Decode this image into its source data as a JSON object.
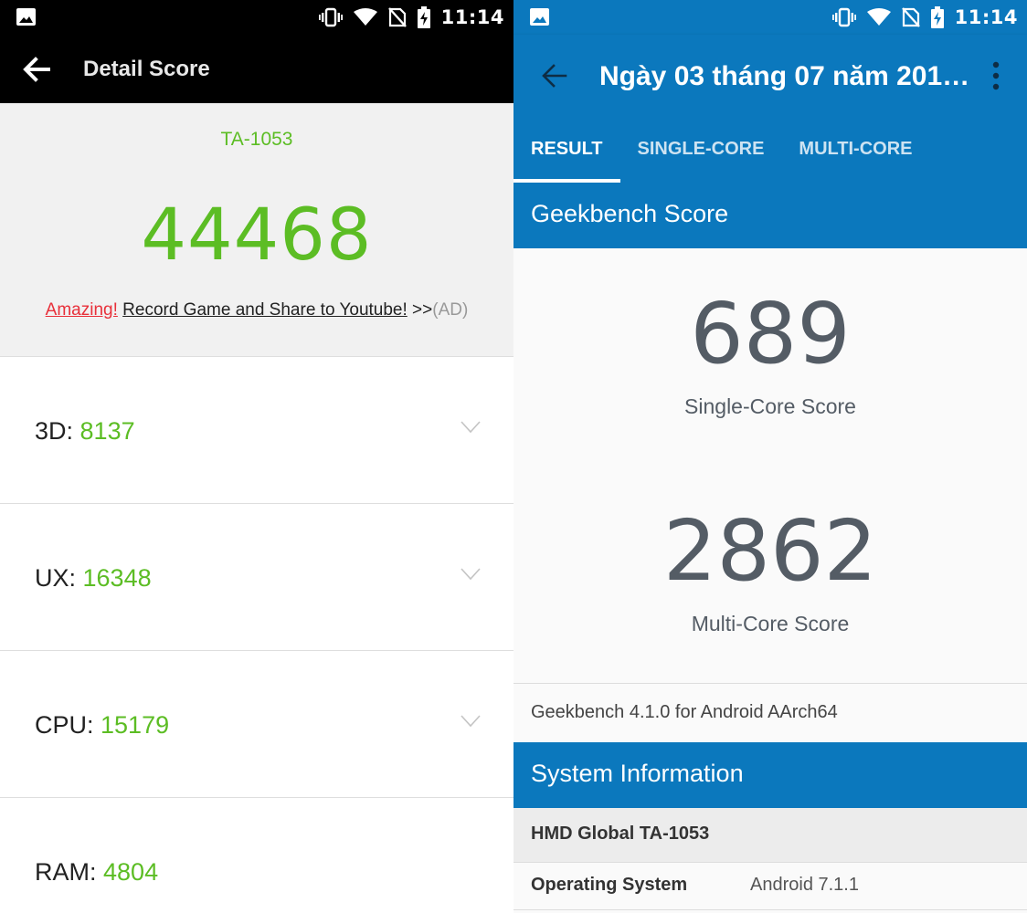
{
  "status_bar": {
    "time": "11:14"
  },
  "antutu": {
    "title": "Detail Score",
    "model": "TA-1053",
    "total_score": "44468",
    "ad": {
      "highlight": "Amazing!",
      "link": "Record Game and Share to Youtube!",
      "arrows": ">>",
      "tag": "(AD)"
    },
    "rows": [
      {
        "label": "3D: ",
        "value": "8137"
      },
      {
        "label": "UX: ",
        "value": "16348"
      },
      {
        "label": "CPU: ",
        "value": "15179"
      },
      {
        "label": "RAM: ",
        "value": "4804"
      }
    ]
  },
  "geekbench": {
    "title": "Ngày 03 tháng 07 năm 201…",
    "tabs": [
      "RESULT",
      "SINGLE-CORE",
      "MULTI-CORE"
    ],
    "active_tab": "RESULT",
    "score_header": "Geekbench Score",
    "single_core": {
      "value": "689",
      "label": "Single-Core Score"
    },
    "multi_core": {
      "value": "2862",
      "label": "Multi-Core Score"
    },
    "version": "Geekbench 4.1.0 for Android AArch64",
    "sysinfo_header": "System Information",
    "device": "HMD Global TA-1053",
    "os": {
      "label": "Operating System",
      "value": "Android 7.1.1"
    }
  },
  "colors": {
    "antutu_green": "#5cbd24",
    "geekbench_blue": "#0b78bd",
    "score_grey": "#545c65",
    "ad_red": "#e8303a"
  }
}
